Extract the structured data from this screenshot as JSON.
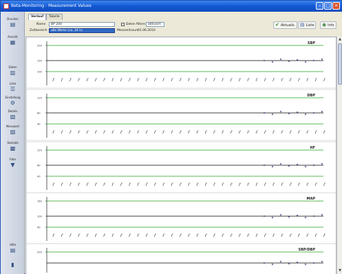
{
  "window": {
    "title": "Beta-Monitoring - Measurement Values"
  },
  "sidebar": {
    "items": [
      {
        "label": "Drucken",
        "icon": "printer-icon",
        "glyph": "▤"
      },
      {
        "label": "Ansicht",
        "icon": "view-icon",
        "glyph": "▦"
      },
      {
        "label": "Daten",
        "icon": "data-icon",
        "glyph": "▥"
      },
      {
        "label": "Liste",
        "icon": "list-icon",
        "glyph": "☰"
      },
      {
        "label": "Einstellung",
        "icon": "settings-icon",
        "glyph": "⚙"
      },
      {
        "label": "Details",
        "icon": "details-icon",
        "glyph": "▧"
      },
      {
        "label": "Messwert",
        "icon": "measurement-icon",
        "glyph": "▨"
      },
      {
        "label": "Statistik",
        "icon": "statistics-icon",
        "glyph": "▩"
      },
      {
        "label": "Filter",
        "icon": "filter-icon",
        "glyph": "▼"
      },
      {
        "label": "Hilfe",
        "icon": "help-icon",
        "glyph": "▤"
      },
      {
        "label": "",
        "icon": "exit-icon",
        "glyph": "▮"
      }
    ]
  },
  "header": {
    "tabs": [
      "Verlauf",
      "Tabelle"
    ],
    "active_tab": 0,
    "field1_label": "Name",
    "field1_value": "BP 200",
    "checkbox_label": "Daten filtern",
    "checkbox_value": "aktiviert",
    "field2_label": "Zeitbereich",
    "field2_value": "alle Werte (ca. 24 h)",
    "field3_label": "Messzeitraum",
    "field3_value": "01.06.2010",
    "buttons": [
      {
        "label": "Aktualis.",
        "icon": "checkmark-icon",
        "glyph": "✔",
        "color": "#2e8b2e"
      },
      {
        "label": "Liste",
        "icon": "print-preview-icon",
        "glyph": "▤",
        "color": "#3a5f9a"
      },
      {
        "label": "Info",
        "icon": "info-icon",
        "glyph": "◉",
        "color": "#3a7d3a"
      }
    ]
  },
  "chart_data": [
    {
      "type": "scatter",
      "title": "SBP",
      "y_ticks": [
        "200",
        "150",
        "100"
      ]
    },
    {
      "type": "scatter",
      "title": "DBP",
      "y_ticks": [
        "120",
        "80",
        "40"
      ]
    },
    {
      "type": "scatter",
      "title": "HF",
      "y_ticks": [
        "120",
        "80",
        "40"
      ]
    },
    {
      "type": "scatter",
      "title": "MAP",
      "y_ticks": [
        "160",
        "100",
        "40"
      ]
    },
    {
      "type": "scatter",
      "title": "SBP/DBP",
      "y_ticks": [
        "200",
        "100"
      ]
    }
  ],
  "colors": {
    "threshold_line": "#1fa31f",
    "baseline": "#000000",
    "marker": "#2a2a6a"
  }
}
